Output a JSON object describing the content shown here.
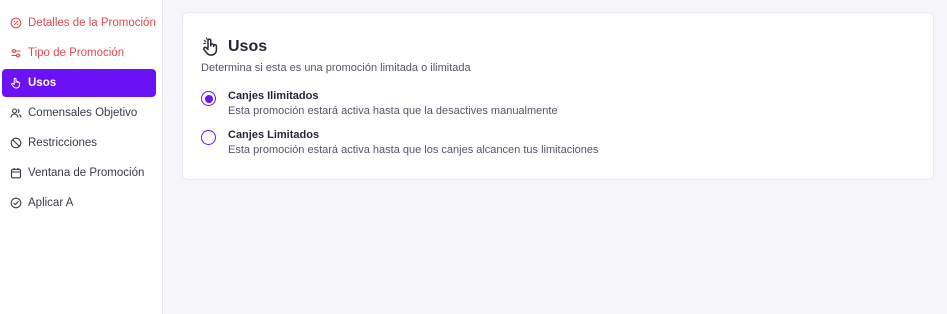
{
  "sidebar": {
    "items": [
      {
        "label": "Detalles de la Promoción",
        "icon": "alert-circle-icon",
        "state": "error"
      },
      {
        "label": "Tipo de Promoción",
        "icon": "sliders-icon",
        "state": "error"
      },
      {
        "label": "Usos",
        "icon": "hand-pointer-icon",
        "state": "active"
      },
      {
        "label": "Comensales Objetivo",
        "icon": "users-icon",
        "state": "normal"
      },
      {
        "label": "Restricciones",
        "icon": "ban-icon",
        "state": "normal"
      },
      {
        "label": "Ventana de Promoción",
        "icon": "calendar-icon",
        "state": "normal"
      },
      {
        "label": "Aplicar A",
        "icon": "check-circle-icon",
        "state": "normal"
      }
    ]
  },
  "section": {
    "icon": "hand-pointer-icon",
    "title": "Usos",
    "description": "Determina si esta es una promoción limitada o ilimitada",
    "options": [
      {
        "title": "Canjes Ilimitados",
        "description": "Esta promoción estará activa hasta que la desactives manualmente",
        "selected": true
      },
      {
        "title": "Canjes Limitados",
        "description": "Esta promoción estará activa hasta que los canjes alcancen tus limitaciones",
        "selected": false
      }
    ]
  },
  "colors": {
    "accent": "#6a11f5",
    "error": "#e0484f",
    "background": "#f6f6fa"
  }
}
